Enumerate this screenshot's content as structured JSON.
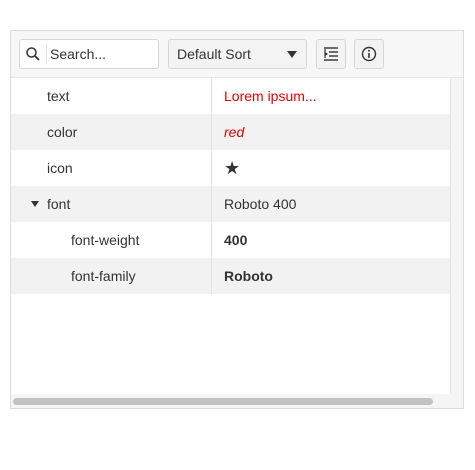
{
  "toolbar": {
    "search_placeholder": "Search...",
    "sort_label": "Default Sort"
  },
  "rows": [
    {
      "name": "text",
      "value": "Lorem ipsum...",
      "value_color": "#e60000"
    },
    {
      "name": "color",
      "value": "red",
      "value_color": "#e60000"
    },
    {
      "name": "icon",
      "value": "★",
      "value_color": "#333333"
    },
    {
      "name": "font",
      "value": "Roboto 400",
      "value_color": "#333333"
    },
    {
      "name": "font-weight",
      "value": "400",
      "value_color": "#333333"
    },
    {
      "name": "font-family",
      "value": "Roboto",
      "value_color": "#333333"
    }
  ],
  "colors": {
    "accent_red": "#e60000",
    "row_alt": "#f2f2f2"
  }
}
